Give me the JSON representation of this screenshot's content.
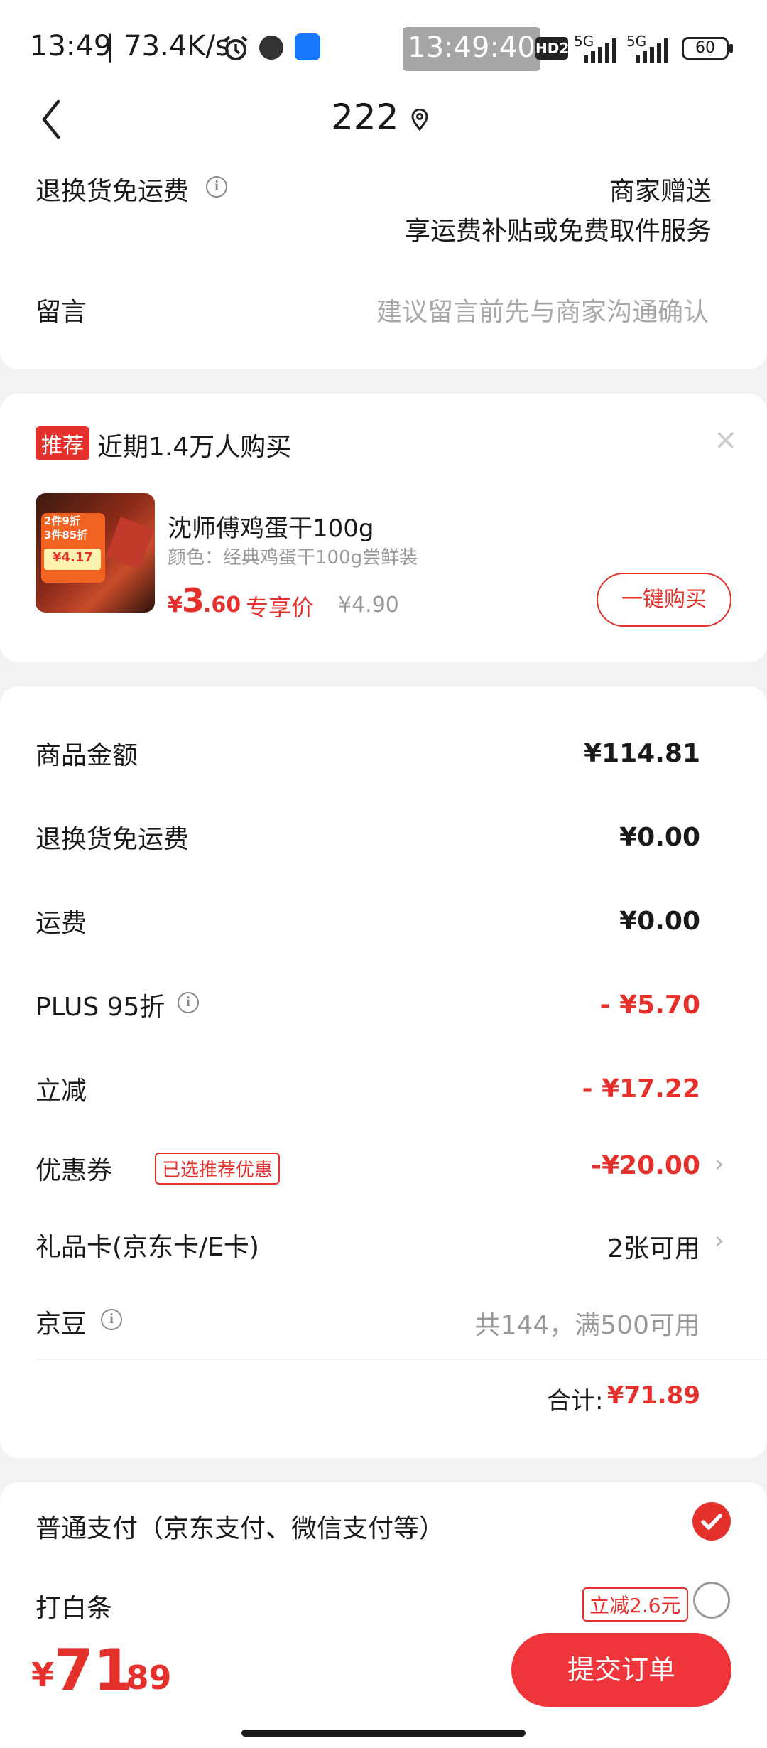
{
  "status_bar": {
    "time": "13:49",
    "speed": "| 73.4K/s",
    "clock_overlay": "13:49:40",
    "hd": "HD2",
    "net1": "5G",
    "net2": "5G",
    "battery": "60"
  },
  "nav": {
    "title": "222"
  },
  "shipping_card": {
    "free_return_label": "退换货免运费",
    "free_return_value_line1": "商家赠送",
    "free_return_value_line2": "享运费补贴或免费取件服务",
    "message_label": "留言",
    "message_placeholder": "建议留言前先与商家沟通确认"
  },
  "recommend_card": {
    "tag": "推荐",
    "headline": "近期1.4万人购买",
    "product_name": "沈师傅鸡蛋干100g",
    "product_spec": "颜色：经典鸡蛋干100g尝鲜装",
    "price_symbol": "¥",
    "price_int": "3",
    "price_dec": ".60",
    "price_tag": "专享价",
    "original_price": "¥4.90",
    "buy_button": "一键购买",
    "thumb_text_line1": "2件9折",
    "thumb_text_line2": "3件85折",
    "thumb_price": "¥4.17"
  },
  "summary_card": {
    "rows": [
      {
        "label": "商品金额",
        "value": "¥114.81"
      },
      {
        "label": "退换货免运费",
        "value": "¥0.00"
      },
      {
        "label": "运费",
        "value": "¥0.00"
      },
      {
        "label": "PLUS 95折",
        "value": "- ¥5.70"
      },
      {
        "label": "立减",
        "value": "- ¥17.22"
      },
      {
        "label": "优惠券",
        "value": "-¥20.00",
        "tag": "已选推荐优惠"
      },
      {
        "label": "礼品卡(京东卡/E卡)",
        "value": "2张可用"
      },
      {
        "label": "京豆",
        "value": "共144，满500可用"
      }
    ],
    "total_label": "合计:",
    "total_value": "¥71.89"
  },
  "payment_card": {
    "normal_pay": "普通支付（京东支付、微信支付等）",
    "baitiao": "打白条",
    "baitiao_tag": "立减2.6元"
  },
  "bottom_bar": {
    "price_symbol": "¥",
    "price_int": "71",
    "price_dec": ".89",
    "submit": "提交订单"
  },
  "colors": {
    "accent": "#e4312b",
    "background": "#f2f2f2"
  }
}
